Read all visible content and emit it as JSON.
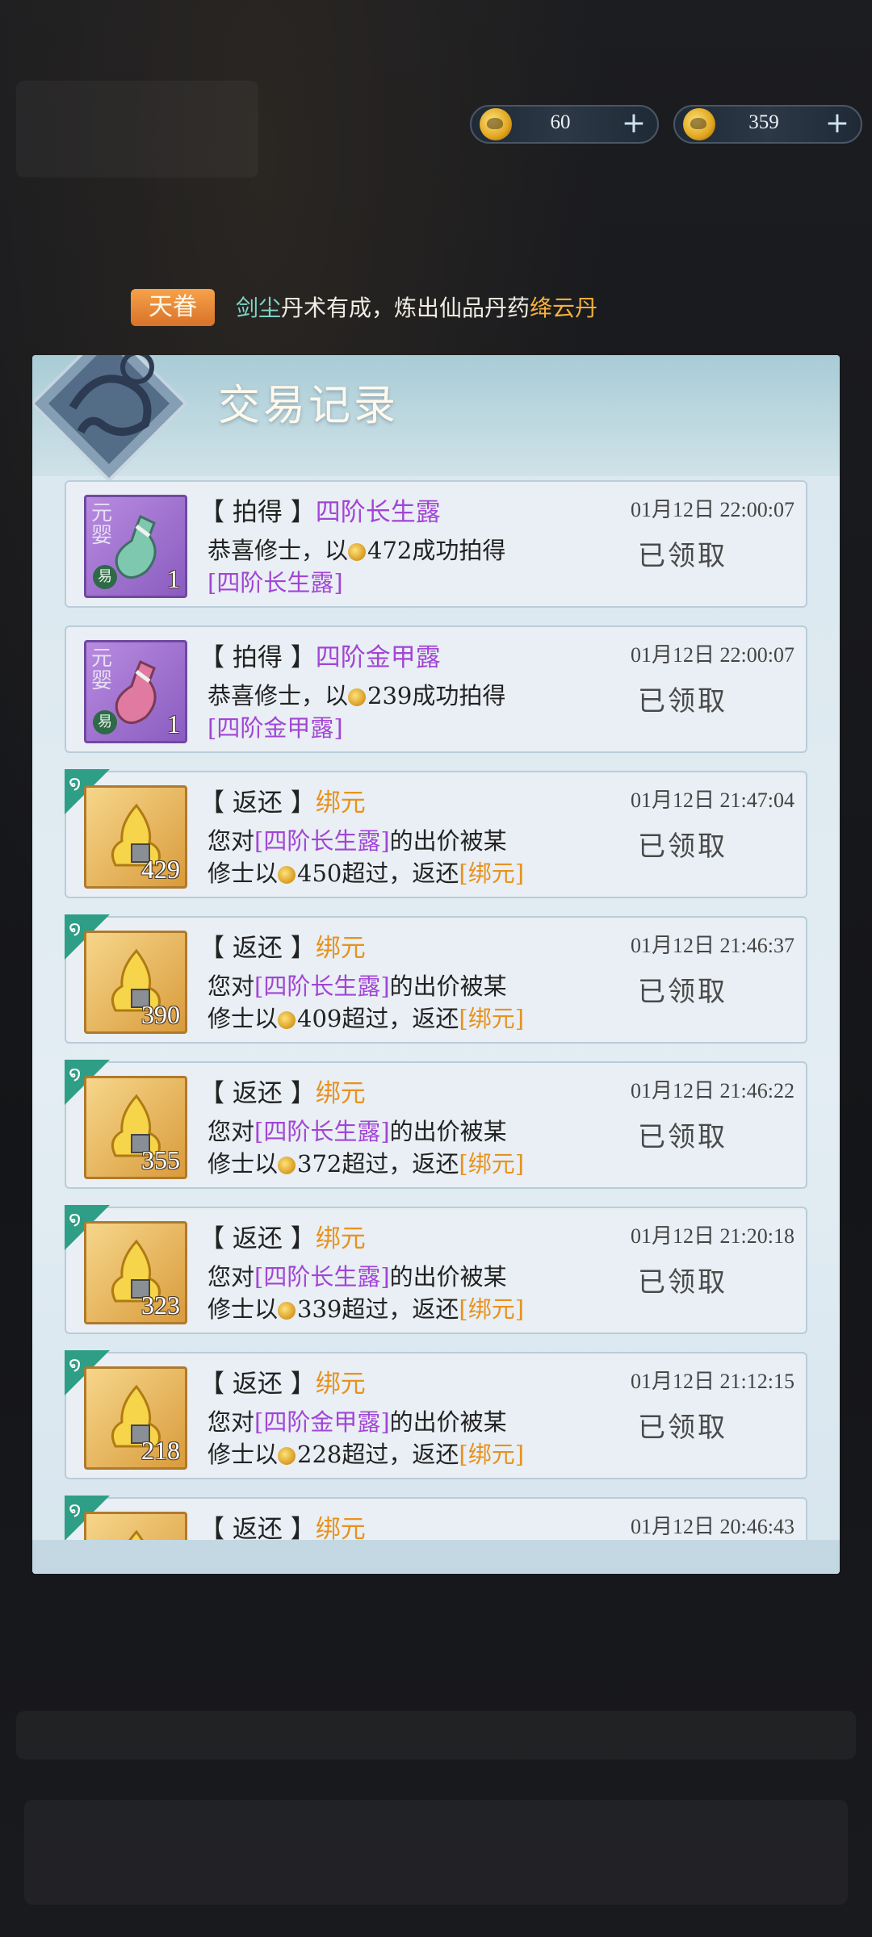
{
  "currencies": [
    {
      "amount": "60",
      "plus": "+",
      "icon": "gold-coin-icon"
    },
    {
      "amount": "359",
      "plus": "+",
      "icon": "silver-gold-coin-icon"
    }
  ],
  "announcement": {
    "tag": "天眷",
    "name": "剑尘",
    "message": "丹术有成，炼出仙品丹药",
    "item": "绛云丹"
  },
  "panel": {
    "title": "交易记录"
  },
  "records": [
    {
      "type": "拍得",
      "item": "四阶长生露",
      "time": "01月12日 22:00:07",
      "line1_prefix": "恭喜修士，以",
      "amount": "472",
      "line1_suffix": "成功拍得",
      "line2_item": "[四阶长生露]",
      "status": "已领取",
      "count": "1",
      "icon_kind": "purple",
      "badge_v": "元婴",
      "badge_yi": "易"
    },
    {
      "type": "拍得",
      "item": "四阶金甲露",
      "time": "01月12日 22:00:07",
      "line1_prefix": "恭喜修士，以",
      "amount": "239",
      "line1_suffix": "成功拍得",
      "line2_item": "[四阶金甲露]",
      "status": "已领取",
      "count": "1",
      "icon_kind": "purple",
      "badge_v": "元婴",
      "badge_yi": "易"
    },
    {
      "type": "返还",
      "item": "绑元",
      "time": "01月12日 21:47:04",
      "line1_prefix": "您对",
      "line1_item": "[四阶长生露]",
      "line1_suffix": "的出价被某",
      "line2_prefix": "修士以",
      "amount": "450",
      "line2_mid": "超过，返还",
      "line2_item": "[绑元]",
      "status": "已领取",
      "count": "429",
      "icon_kind": "gold"
    },
    {
      "type": "返还",
      "item": "绑元",
      "time": "01月12日 21:46:37",
      "line1_prefix": "您对",
      "line1_item": "[四阶长生露]",
      "line1_suffix": "的出价被某",
      "line2_prefix": "修士以",
      "amount": "409",
      "line2_mid": "超过，返还",
      "line2_item": "[绑元]",
      "status": "已领取",
      "count": "390",
      "icon_kind": "gold"
    },
    {
      "type": "返还",
      "item": "绑元",
      "time": "01月12日 21:46:22",
      "line1_prefix": "您对",
      "line1_item": "[四阶长生露]",
      "line1_suffix": "的出价被某",
      "line2_prefix": "修士以",
      "amount": "372",
      "line2_mid": "超过，返还",
      "line2_item": "[绑元]",
      "status": "已领取",
      "count": "355",
      "icon_kind": "gold"
    },
    {
      "type": "返还",
      "item": "绑元",
      "time": "01月12日 21:20:18",
      "line1_prefix": "您对",
      "line1_item": "[四阶长生露]",
      "line1_suffix": "的出价被某",
      "line2_prefix": "修士以",
      "amount": "339",
      "line2_mid": "超过，返还",
      "line2_item": "[绑元]",
      "status": "已领取",
      "count": "323",
      "icon_kind": "gold"
    },
    {
      "type": "返还",
      "item": "绑元",
      "time": "01月12日 21:12:15",
      "line1_prefix": "您对",
      "line1_item": "[四阶金甲露]",
      "line1_suffix": "的出价被某",
      "line2_prefix": "修士以",
      "amount": "228",
      "line2_mid": "超过，返还",
      "line2_item": "[绑元]",
      "status": "已领取",
      "count": "218",
      "icon_kind": "gold"
    },
    {
      "type": "返还",
      "item": "绑元",
      "time": "01月12日 20:46:43",
      "icon_kind": "gold"
    }
  ],
  "colors": {
    "purple_text": "#a245d6",
    "gold_text": "#e8921e",
    "corner_teal": "#2e9e86"
  }
}
